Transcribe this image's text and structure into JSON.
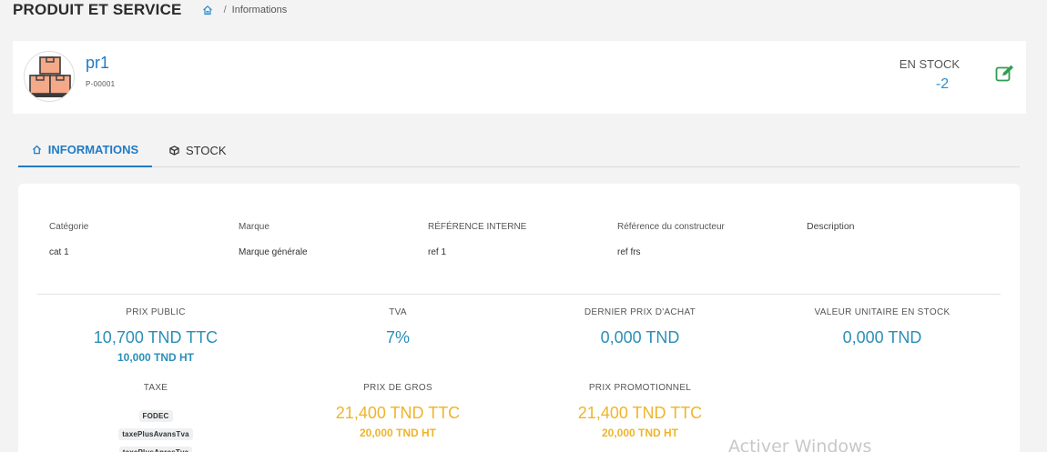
{
  "header": {
    "title": "PRODUIT ET SERVICE",
    "breadcrumb_sep": "/",
    "breadcrumb_current": "Informations"
  },
  "product": {
    "name": "pr1",
    "ref": "P-00001",
    "stock_label": "EN STOCK",
    "stock_value": "-2"
  },
  "tabs": [
    {
      "label": "INFORMATIONS",
      "icon": "home-icon",
      "active": true
    },
    {
      "label": "STOCK",
      "icon": "cube-icon",
      "active": false
    }
  ],
  "details": {
    "categorie_label": "Catégorie",
    "categorie_value": "cat 1",
    "marque_label": "Marque",
    "marque_value": "Marque générale",
    "ref_interne_label": "RÉFÉRENCE INTERNE",
    "ref_interne_value": "ref 1",
    "ref_constructeur_label": "Référence du constructeur",
    "ref_constructeur_value": "ref frs",
    "description_label": "Description"
  },
  "prices": {
    "prix_public_label": "PRIX PUBLIC",
    "prix_public_ttc": "10,700 TND TTC",
    "prix_public_ht": "10,000 TND HT",
    "tva_label": "TVA",
    "tva_value": "7%",
    "dernier_prix_label": "DERNIER PRIX D'ACHAT",
    "dernier_prix_value": "0,000 TND",
    "valeur_stock_label": "VALEUR UNITAIRE EN STOCK",
    "valeur_stock_value": "0,000 TND",
    "taxe_label": "TAXE",
    "taxes": [
      "FODEC",
      "taxePlusAvansTva",
      "taxePlusApresTva"
    ],
    "prix_gros_label": "PRIX DE GROS",
    "prix_gros_ttc": "21,400 TND TTC",
    "prix_gros_ht": "20,000 TND HT",
    "prix_promo_label": "PRIX PROMOTIONNEL",
    "prix_promo_ttc": "21,400 TND TTC",
    "prix_promo_ht": "20,000 TND HT"
  },
  "watermark": "Activer Windows",
  "colors": {
    "accent": "#1f7bc4",
    "price_blue": "#2b8fb8",
    "price_orange": "#f0b429",
    "edit_green": "#2e9e4f"
  }
}
